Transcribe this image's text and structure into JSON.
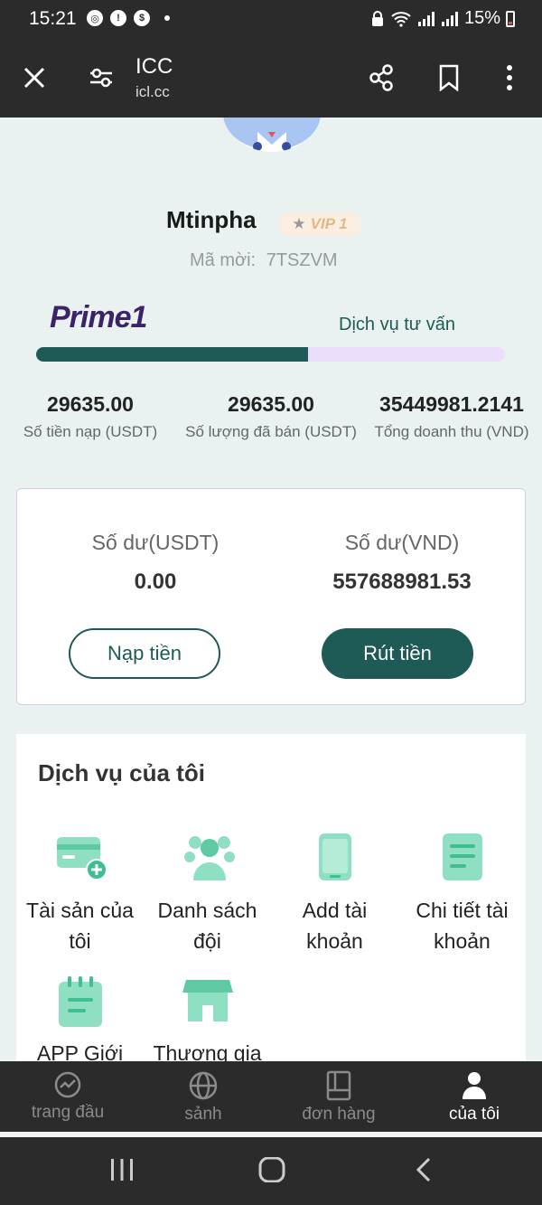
{
  "status_bar": {
    "time": "15:21",
    "icons": [
      "chrome-icon",
      "alert-icon",
      "shop-icon"
    ],
    "battery": "15%"
  },
  "browser": {
    "title": "ICC",
    "url": "icl.cc"
  },
  "profile": {
    "username": "Mtinpha",
    "vip": "VIP 1",
    "invite_label": "Mã mời:",
    "invite_code": "7TSZVM"
  },
  "level": {
    "name": "Prime1",
    "service_link": "Dịch vụ tư vấn",
    "progress": 0.58
  },
  "stats": [
    {
      "value": "29635.00",
      "label": "Số tiền nạp (USDT)"
    },
    {
      "value": "29635.00",
      "label": "Số lượng đã bán (USDT)"
    },
    {
      "value": "35449981.2141",
      "label": "Tổng doanh thu (VND)"
    }
  ],
  "balance": {
    "usdt_label": "Số dư(USDT)",
    "usdt_value": "0.00",
    "vnd_label": "Số dư(VND)",
    "vnd_value": "557688981.53",
    "deposit_label": "Nạp tiền",
    "withdraw_label": "Rút tiền"
  },
  "services": {
    "title": "Dịch vụ của tôi",
    "items": [
      {
        "line1": "Tài sản của",
        "line2": "tôi",
        "icon": "card-add-icon"
      },
      {
        "line1": "Danh sách",
        "line2": "đội",
        "icon": "team-icon"
      },
      {
        "line1": "Add tài",
        "line2": "khoản",
        "icon": "phone-icon"
      },
      {
        "line1": "Chi tiết tài",
        "line2": "khoản",
        "icon": "document-icon"
      },
      {
        "line1": "APP Giới",
        "line2": "",
        "icon": "calendar-icon"
      },
      {
        "line1": "Thương gia",
        "line2": "",
        "icon": "store-icon"
      }
    ]
  },
  "nav": [
    {
      "label": "trang đầu",
      "icon": "chart-icon"
    },
    {
      "label": "sảnh",
      "icon": "globe-icon"
    },
    {
      "label": "đơn hàng",
      "icon": "book-icon"
    },
    {
      "label": "của tôi",
      "icon": "user-icon"
    }
  ],
  "colors": {
    "primary": "#1e5a56",
    "vip_bg": "#fbeee0",
    "progress_bg": "#ebdefa",
    "icon_green": "#7fd8b9"
  }
}
